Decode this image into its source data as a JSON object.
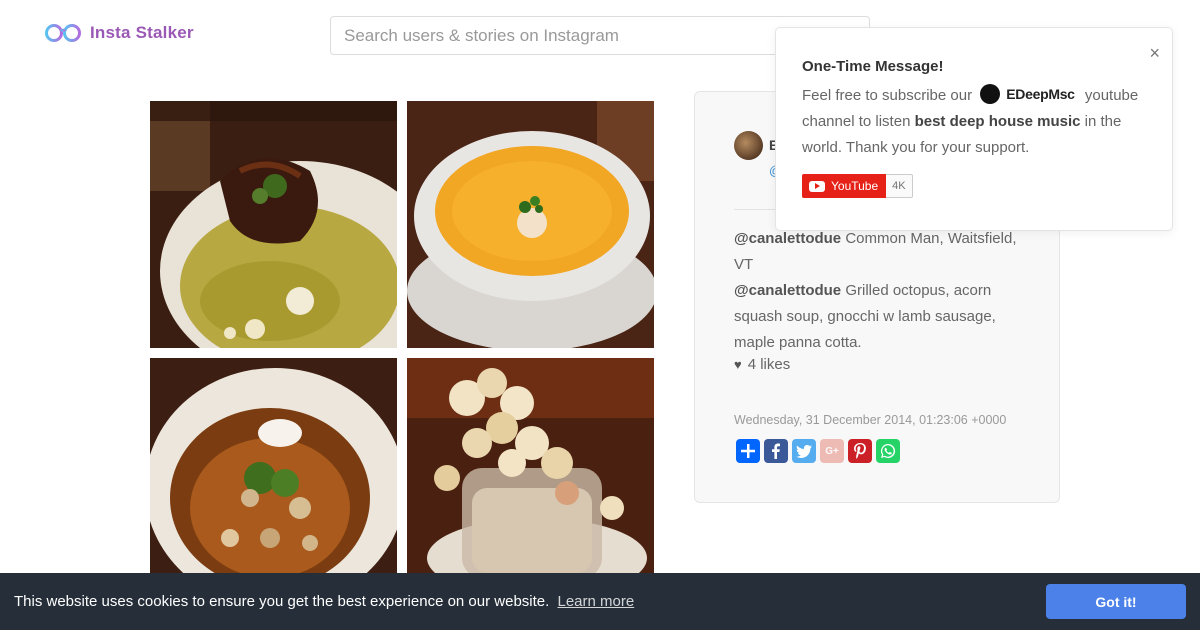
{
  "header": {
    "logo_text": "Insta Stalker",
    "logo_icon": "glasses-icon",
    "search_placeholder": "Search users & stories on Instagram"
  },
  "post": {
    "author_initial": "E",
    "author_handle_stub": "@",
    "captions": [
      {
        "mention": "@canalettodue",
        "text": " Common Man, Waitsfield, VT"
      },
      {
        "mention": "@canalettodue",
        "text": " Grilled octopus, acorn squash soup, gnocchi w lamb sausage, maple panna cotta."
      }
    ],
    "likes": "4 likes",
    "timestamp": "Wednesday, 31 December 2014, 01:23:06 +0000",
    "share_buttons": [
      {
        "name": "share-plus-icon",
        "color": "#0166ff",
        "glyph": "+"
      },
      {
        "name": "facebook-icon",
        "color": "#3b5998",
        "glyph": "f"
      },
      {
        "name": "twitter-icon",
        "color": "#55acee",
        "glyph": "t"
      },
      {
        "name": "google-plus-icon",
        "color": "#dd4b39",
        "glyph": "G+"
      },
      {
        "name": "pinterest-icon",
        "color": "#cb2027",
        "glyph": "P"
      },
      {
        "name": "whatsapp-icon",
        "color": "#25d366",
        "glyph": "w"
      }
    ],
    "photos": [
      {
        "name": "photo-grilled-octopus"
      },
      {
        "name": "photo-acorn-squash-soup"
      },
      {
        "name": "photo-gnocchi-lamb-sausage"
      },
      {
        "name": "photo-maple-panna-cotta"
      }
    ]
  },
  "popup": {
    "close": "×",
    "title": "One-Time Message!",
    "body_prefix": "Feel free to subscribe our",
    "channel_name": "EDeepMsc",
    "body_mid": "youtube channel to listen",
    "body_bold": "best deep house music",
    "body_suffix": "in the world. Thank you for your support.",
    "youtube_label": "YouTube",
    "youtube_count": "4K"
  },
  "cookie": {
    "message": "This website uses cookies to ensure you get the best experience on our website.",
    "learn_more": "Learn more",
    "button": "Got it!"
  },
  "colors": {
    "brand": "#9b59b6",
    "cookie_bar": "#252e39",
    "cookie_button": "#4b81e8",
    "youtube_red": "#e62117"
  }
}
